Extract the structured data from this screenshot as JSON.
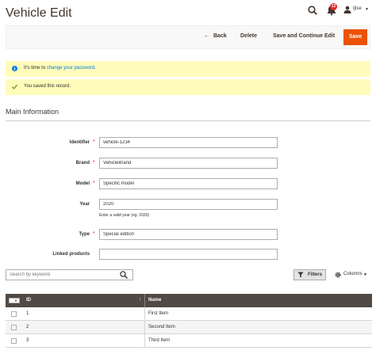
{
  "header": {
    "title": "Vehicle Edit",
    "notification_count": "12",
    "user_name": "tjlse"
  },
  "actions": {
    "back_label": "Back",
    "delete_label": "Delete",
    "save_continue_label": "Save and Continue Edit",
    "save_label": "Save"
  },
  "messages": {
    "password_prefix": "It's time to ",
    "password_link": "change your password",
    "password_suffix": ".",
    "saved": "You saved this record."
  },
  "section": {
    "title": "Main Information"
  },
  "form": {
    "identifier_label": "Identifier",
    "identifier_value": "vehicle-1234",
    "brand_label": "Brand",
    "brand_value": "VehicleBrand",
    "model_label": "Model",
    "model_value": "Specific model",
    "year_label": "Year",
    "year_value": "2020",
    "year_note": "Enter a valid year (eg: 2020)",
    "type_label": "Type",
    "type_value": "Special edition",
    "linked_label": "Linked products",
    "linked_value": ""
  },
  "grid_toolbar": {
    "search_placeholder": "Search by keyword",
    "filters_label": "Filters",
    "columns_label": "Columns"
  },
  "grid": {
    "col_id": "ID",
    "col_name": "Name",
    "rows": [
      {
        "id": "1",
        "name": "First Item"
      },
      {
        "id": "2",
        "name": "Second Item"
      },
      {
        "id": "3",
        "name": "Third Item"
      }
    ]
  },
  "colors": {
    "accent": "#eb5202",
    "message_bg": "#fffbbb",
    "grid_header": "#514943",
    "link": "#007bdb",
    "required": "#e22626"
  }
}
